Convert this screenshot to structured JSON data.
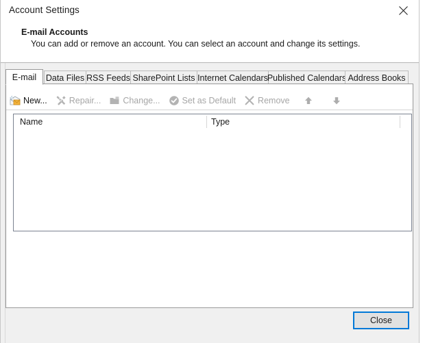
{
  "window": {
    "title": "Account Settings",
    "close_icon": "close-icon"
  },
  "header": {
    "heading": "E-mail Accounts",
    "description": "You can add or remove an account. You can select an account and change its settings."
  },
  "tabs": [
    {
      "label": "E-mail",
      "selected": true
    },
    {
      "label": "Data Files",
      "selected": false
    },
    {
      "label": "RSS Feeds",
      "selected": false
    },
    {
      "label": "SharePoint Lists",
      "selected": false
    },
    {
      "label": "Internet Calendars",
      "selected": false
    },
    {
      "label": "Published Calendars",
      "selected": false
    },
    {
      "label": "Address Books",
      "selected": false
    }
  ],
  "toolbar": {
    "buttons": [
      {
        "label": "New...",
        "icon": "new-email-icon",
        "enabled": true
      },
      {
        "label": "Repair...",
        "icon": "repair-tools-icon",
        "enabled": false
      },
      {
        "label": "Change...",
        "icon": "change-folder-icon",
        "enabled": false
      },
      {
        "label": "Set as Default",
        "icon": "check-circle-icon",
        "enabled": false
      },
      {
        "label": "Remove",
        "icon": "x-cross-icon",
        "enabled": false
      }
    ],
    "move_up": {
      "label": "",
      "icon": "arrow-up-icon",
      "enabled": false
    },
    "move_down": {
      "label": "",
      "icon": "arrow-down-icon",
      "enabled": false
    }
  },
  "accounts_list": {
    "columns": [
      "Name",
      "Type"
    ],
    "rows": []
  },
  "footer": {
    "close_label": "Close"
  },
  "colors": {
    "focus_border": "#0078d7",
    "button_face": "#e1e1e1",
    "dialog_bg": "#f0f0f0",
    "panel_bg": "#ffffff",
    "disabled_text": "#a6a6a6",
    "list_border": "#7a8290"
  }
}
